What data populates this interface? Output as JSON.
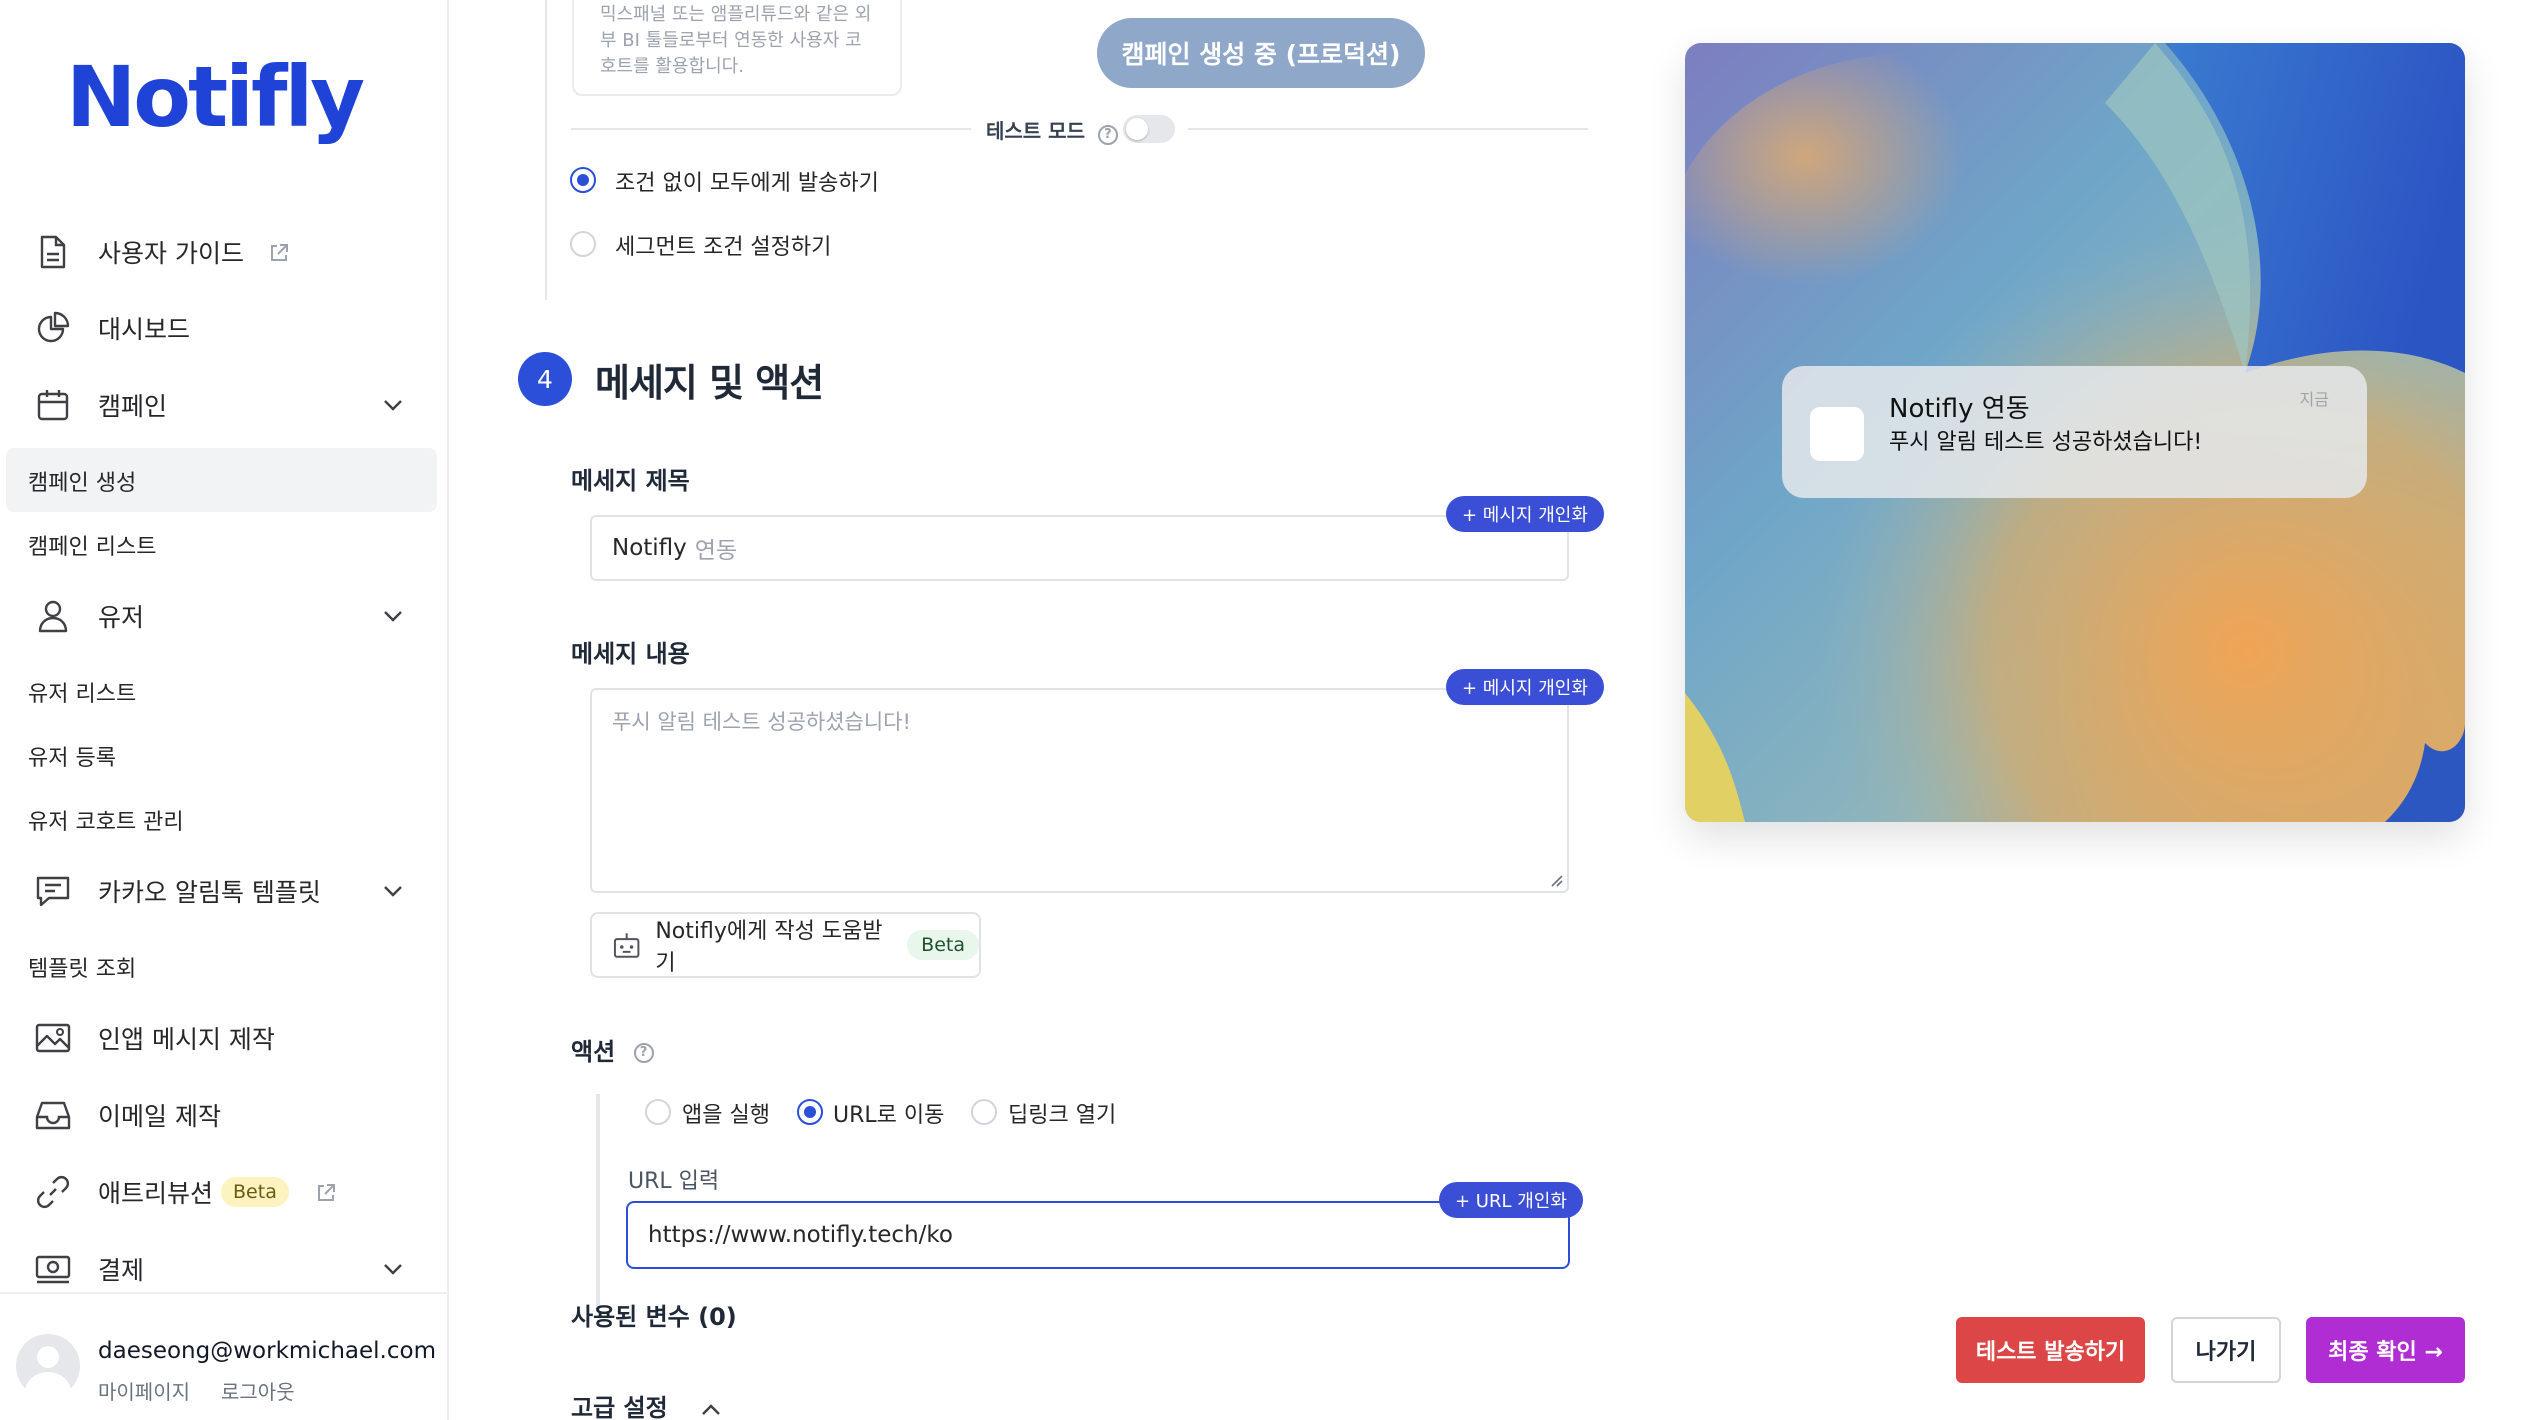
{
  "brand": {
    "logo": "Notifly"
  },
  "sidebar": {
    "user_guide": "사용자 가이드",
    "dashboard": "대시보드",
    "campaign": "캠페인",
    "campaign_create": "캠페인 생성",
    "campaign_list": "캠페인 리스트",
    "user": "유저",
    "user_list": "유저 리스트",
    "user_register": "유저 등록",
    "user_cohort": "유저 코호트 관리",
    "kakao_template": "카카오 알림톡 템플릿",
    "template_view": "템플릿 조회",
    "inapp": "인앱 메시지 제작",
    "email": "이메일 제작",
    "attribution": "애트리뷰션",
    "attribution_badge": "Beta",
    "payment": "결제"
  },
  "user": {
    "email": "daeseong@workmichael.com",
    "mypage": "마이페이지",
    "logout": "로그아웃"
  },
  "segment": {
    "note": "믹스패널 또는 앰플리튜드와 같은 외부 BI 툴들로부터 연동한 사용자 코호트를 활용합니다.",
    "creating_button": "캠페인 생성 중 (프로덕션)",
    "test_mode_label": "테스트 모드",
    "help_icon": "?",
    "option_all": "조건 없이 모두에게 발송하기",
    "option_segment": "세그먼트 조건 설정하기"
  },
  "message": {
    "step_number": "4",
    "section_title": "메세지 및 액션",
    "title_label": "메세지 제목",
    "title_value": "Notifly",
    "title_placeholder_suffix": "연동",
    "personalize_label": "+ 메시지 개인화",
    "body_label": "메세지 내용",
    "body_placeholder": "푸시 알림 테스트 성공하셨습니다!",
    "ai_help": "Notifly에게 작성 도움받기",
    "ai_badge": "Beta"
  },
  "action": {
    "label": "액션",
    "options": [
      "앱을 실행",
      "URL로 이동",
      "딥링크 열기"
    ],
    "selected": "URL로 이동",
    "url_label": "URL 입력",
    "url_value": "https://www.notifly.tech/ko",
    "url_personalize": "+ URL 개인화"
  },
  "variables": {
    "label": "사용된 변수 (0)"
  },
  "advanced": {
    "label": "고급 설정"
  },
  "preview": {
    "notif_title": "Notifly 연동",
    "notif_body": "푸시 알림 테스트 성공하셨습니다!",
    "notif_time": "지금"
  },
  "footer": {
    "test_send": "테스트 발송하기",
    "exit": "나가기",
    "confirm": "최종 확인 →"
  },
  "colors": {
    "brand_blue": "#1f43d6",
    "accent_blue": "#2c4fd9",
    "red_button": "#dc4646",
    "purple_button": "#b02dd4"
  }
}
